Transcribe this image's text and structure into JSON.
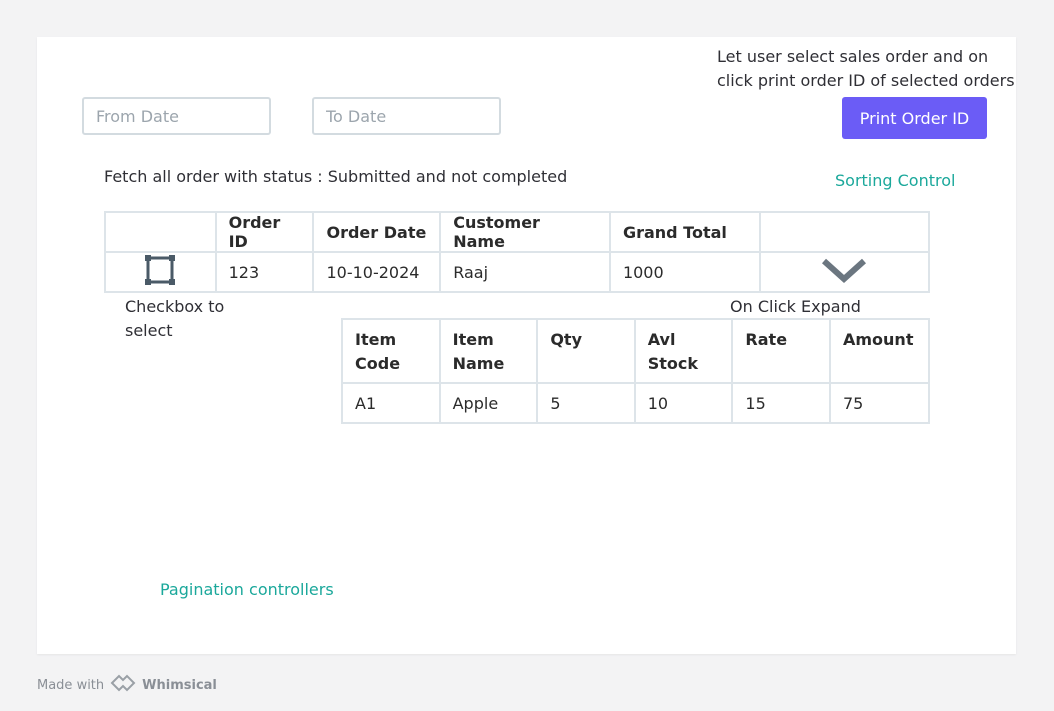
{
  "notes": {
    "print_note": "Let user select sales order and on click print order ID of selected orders",
    "fetch_note": "Fetch all order with status : Submitted and not completed",
    "checkbox_note": "Checkbox to select",
    "expand_note": "On Click Expand",
    "sorting": "Sorting Control",
    "pagination": "Pagination controllers"
  },
  "filters": {
    "from_placeholder": "From Date",
    "to_placeholder": "To Date"
  },
  "print_button": "Print Order ID",
  "orders": {
    "headers": [
      "",
      "Order ID",
      "Order Date",
      "Customer Name",
      "Grand Total",
      ""
    ],
    "rows": [
      {
        "order_id": "123",
        "order_date": "10-10-2024",
        "customer_name": "Raaj",
        "grand_total": "1000"
      }
    ]
  },
  "items": {
    "headers": [
      "Item Code",
      "Item Name",
      "Qty",
      "Avl Stock",
      "Rate",
      "Amount"
    ],
    "rows": [
      {
        "item_code": "A1",
        "item_name": "Apple",
        "qty": "5",
        "avl_stock": "10",
        "rate": "15",
        "amount": "75"
      }
    ]
  },
  "footer": {
    "made_with": "Made with",
    "brand": "Whimsical"
  },
  "colors": {
    "accent": "#6b5cf6",
    "teal": "#1ba89b",
    "border": "#dde4e9"
  },
  "icons": {
    "checkbox": "checkbox-icon",
    "expand": "chevron-down-icon",
    "logo": "whimsical-logo-icon"
  }
}
